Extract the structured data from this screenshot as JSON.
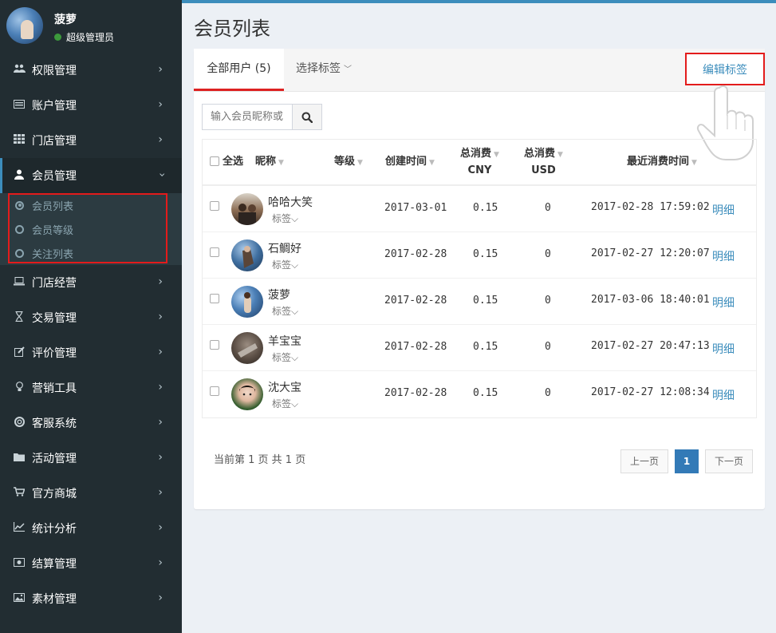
{
  "sidebar": {
    "user_name": "菠萝",
    "user_role": "超级管理员",
    "menu": [
      {
        "label": "权限管理",
        "icon": "users-icon"
      },
      {
        "label": "账户管理",
        "icon": "list-icon"
      },
      {
        "label": "门店管理",
        "icon": "grid-icon"
      },
      {
        "label": "会员管理",
        "icon": "user-icon"
      },
      {
        "label": "门店经营",
        "icon": "laptop-icon"
      },
      {
        "label": "交易管理",
        "icon": "hourglass-icon"
      },
      {
        "label": "评价管理",
        "icon": "edit-icon"
      },
      {
        "label": "营销工具",
        "icon": "lightbulb-icon"
      },
      {
        "label": "客服系统",
        "icon": "lifebuoy-icon"
      },
      {
        "label": "活动管理",
        "icon": "folder-icon"
      },
      {
        "label": "官方商城",
        "icon": "cart-icon"
      },
      {
        "label": "统计分析",
        "icon": "line-chart-icon"
      },
      {
        "label": "结算管理",
        "icon": "money-icon"
      },
      {
        "label": "素材管理",
        "icon": "image-icon"
      }
    ],
    "submenu": [
      "会员列表",
      "会员等级",
      "关注列表"
    ]
  },
  "page": {
    "title": "会员列表"
  },
  "tabs": {
    "all": "全部用户 (5)",
    "tag": "选择标签",
    "edit_tags": "编辑标签"
  },
  "search": {
    "placeholder": "输入会员昵称或"
  },
  "table": {
    "select_all": "全选",
    "headers": {
      "nick": "昵称",
      "level": "等级",
      "created": "创建时间",
      "cny_top": "总消费",
      "cny_bottom": "CNY",
      "usd_top": "总消费",
      "usd_bottom": "USD",
      "last": "最近消费时间"
    },
    "tag_label": "标签",
    "detail_label": "明细",
    "rows": [
      {
        "nick": "哈哈大笑",
        "created": "2017-03-01",
        "cny": "0.15",
        "usd": "0",
        "last": "2017-02-28 17:59:02",
        "detail": "明细",
        "tag": "标签"
      },
      {
        "nick": "石鲷好",
        "created": "2017-02-28",
        "cny": "0.15",
        "usd": "0",
        "last": "2017-02-27 12:20:07",
        "detail": "明细",
        "tag": "标签"
      },
      {
        "nick": "菠萝",
        "created": "2017-02-28",
        "cny": "0.15",
        "usd": "0",
        "last": "2017-03-06 18:40:01",
        "detail": "明细",
        "tag": "标签"
      },
      {
        "nick": "羊宝宝",
        "created": "2017-02-28",
        "cny": "0.15",
        "usd": "0",
        "last": "2017-02-27 20:47:13",
        "detail": "明细",
        "tag": "标签"
      },
      {
        "nick": "沈大宝",
        "created": "2017-02-28",
        "cny": "0.15",
        "usd": "0",
        "last": "2017-02-27 12:08:34",
        "detail": "明细",
        "tag": "标签"
      }
    ]
  },
  "pagination": {
    "summary": "当前第 1 页 共 1 页",
    "prev": "上一页",
    "current": "1",
    "next": "下一页"
  },
  "colors": {
    "sidebar_bg": "#222d32",
    "accent": "#3c8dbc",
    "highlight": "#e31b1b"
  }
}
